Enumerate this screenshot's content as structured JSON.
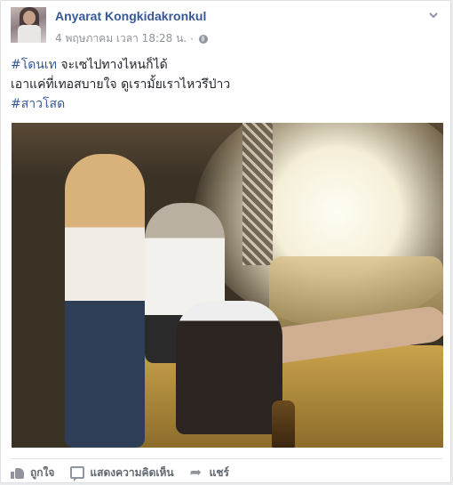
{
  "post": {
    "author": "Anyarat Kongkidakronkul",
    "timestamp": "4 พฤษภาคม เวลา 18:28 น.",
    "separator": "·",
    "privacy_icon": "globe-icon",
    "menu_icon": "chevron-down-icon",
    "text": {
      "line1_tag": "#โดนเท",
      "line1_rest": " จะเซไปทางไหนก็ได้",
      "line2": "เอาแค่ที่เทอสบายใจ ดูเรามั้ยเราไหวรึป่าว",
      "line3_tag": "#สาวโสด"
    }
  },
  "actions": {
    "like_label": "ถูกใจ",
    "comment_label": "แสดงความคิดเห็น",
    "share_label": "แชร์"
  },
  "colors": {
    "link": "#365899",
    "meta": "#90949c",
    "text": "#1d2129"
  }
}
